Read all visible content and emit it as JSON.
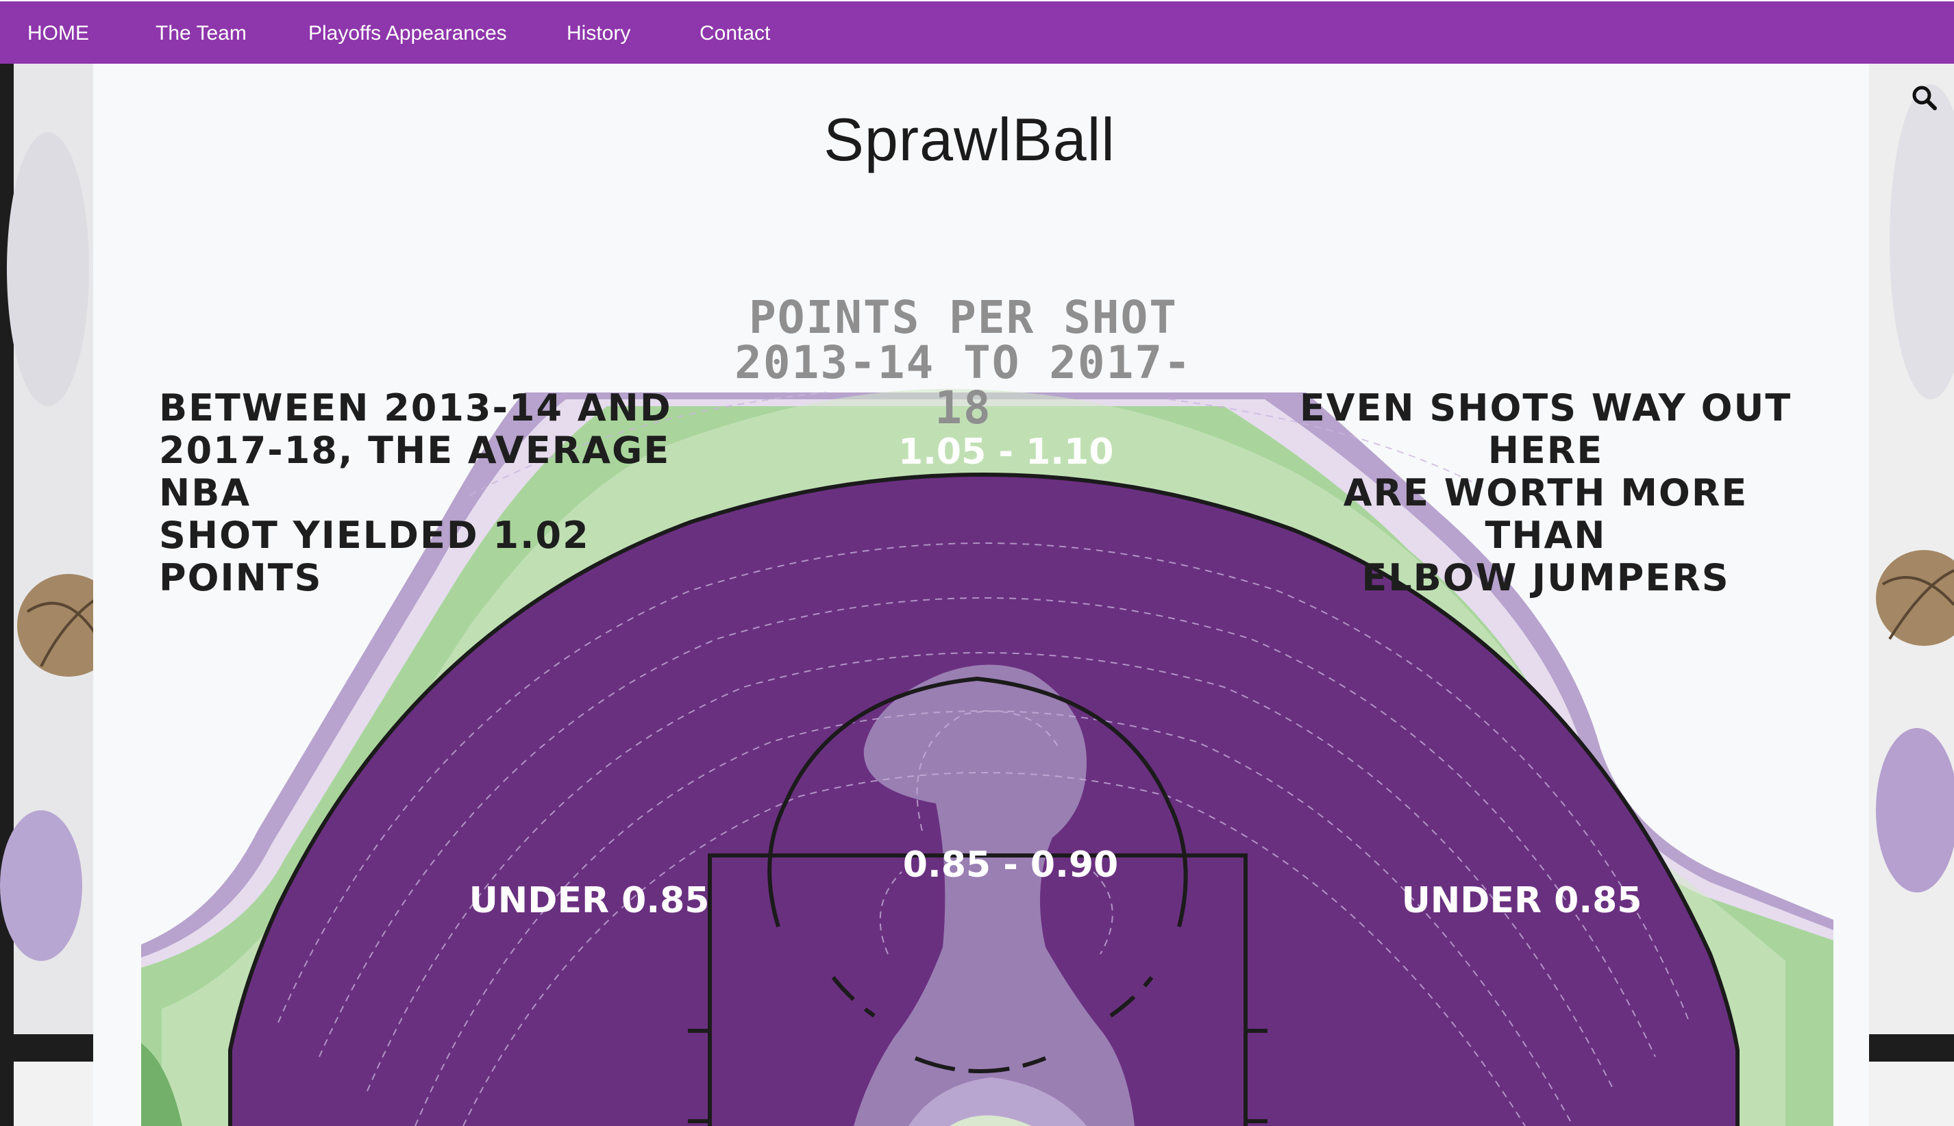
{
  "nav": {
    "items": [
      {
        "label": "HOME"
      },
      {
        "label": "The Team"
      },
      {
        "label": "Playoffs Appearances"
      },
      {
        "label": "History"
      },
      {
        "label": "Contact"
      }
    ]
  },
  "site": {
    "title": "SprawlBall"
  },
  "search": {
    "icon": "search-icon"
  },
  "infographic": {
    "title": "POINTS PER SHOT\n2013-14 TO 2017-18",
    "left_note": "BETWEEN 2013-14 AND\n2017-18, THE AVERAGE NBA\nSHOT YIELDED 1.02\nPOINTS",
    "right_note": "EVEN SHOTS WAY OUT HERE\nARE WORTH MORE THAN\nELBOW JUMPERS",
    "zones": {
      "top_arc": "1.05 - 1.10",
      "paint": "0.85 - 0.90",
      "left_mid": "UNDER 0.85",
      "right_mid": "UNDER 0.85"
    },
    "colors": {
      "dark_purple": "#6a3080",
      "mid_purple": "#7c4b97",
      "light_purple": "#9a7fb3",
      "lavender": "#b7a3cd",
      "pale_lavender": "#e6dcee",
      "pale_green": "#d4e9c9",
      "green": "#a9d59c",
      "dark_green": "#73b06a"
    }
  }
}
